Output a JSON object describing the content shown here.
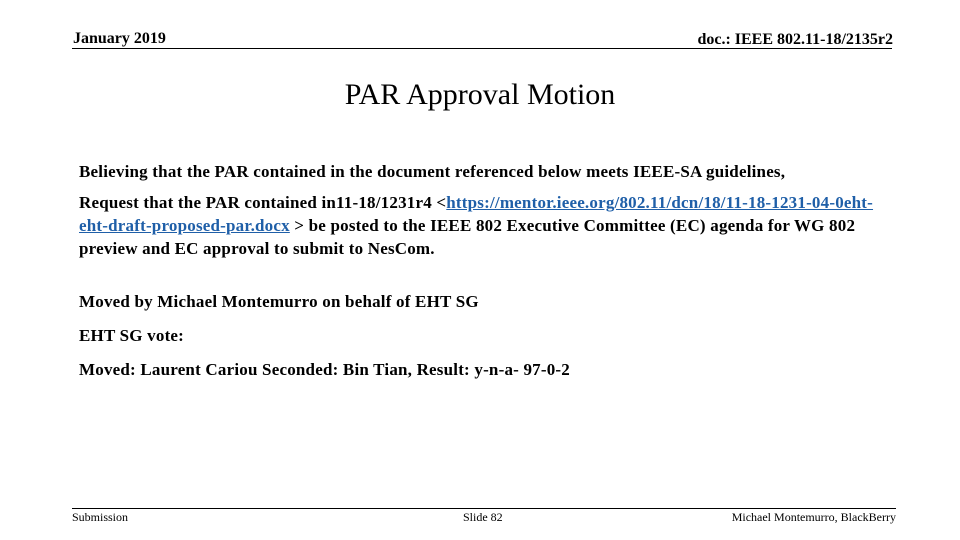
{
  "header": {
    "date": "January 2019",
    "doc_id": "doc.: IEEE 802.11-18/2135r2"
  },
  "title": "PAR Approval Motion",
  "body": {
    "para1": "Believing that the PAR contained in the document referenced below meets IEEE-SA guidelines,",
    "para2_prefix": "Request that the PAR contained in11-18/1231r4 <",
    "para2_link": "https://mentor.ieee.org/802.11/dcn/18/11-18-1231-04-0eht-eht-draft-proposed-par.docx",
    "para2_suffix": " > be posted to the IEEE 802 Executive Committee (EC) agenda for WG 802 preview and EC approval to submit to NesCom.",
    "moved_by": "Moved by Michael Montemurro on behalf of EHT SG",
    "vote_label": "EHT SG vote:",
    "vote_result": "Moved: Laurent Cariou Seconded: Bin Tian, Result: y-n-a- 97-0-2"
  },
  "footer": {
    "left": "Submission",
    "center": "Slide 82",
    "right": "Michael Montemurro, BlackBerry"
  },
  "colors": {
    "link": "#1f5fa8"
  }
}
